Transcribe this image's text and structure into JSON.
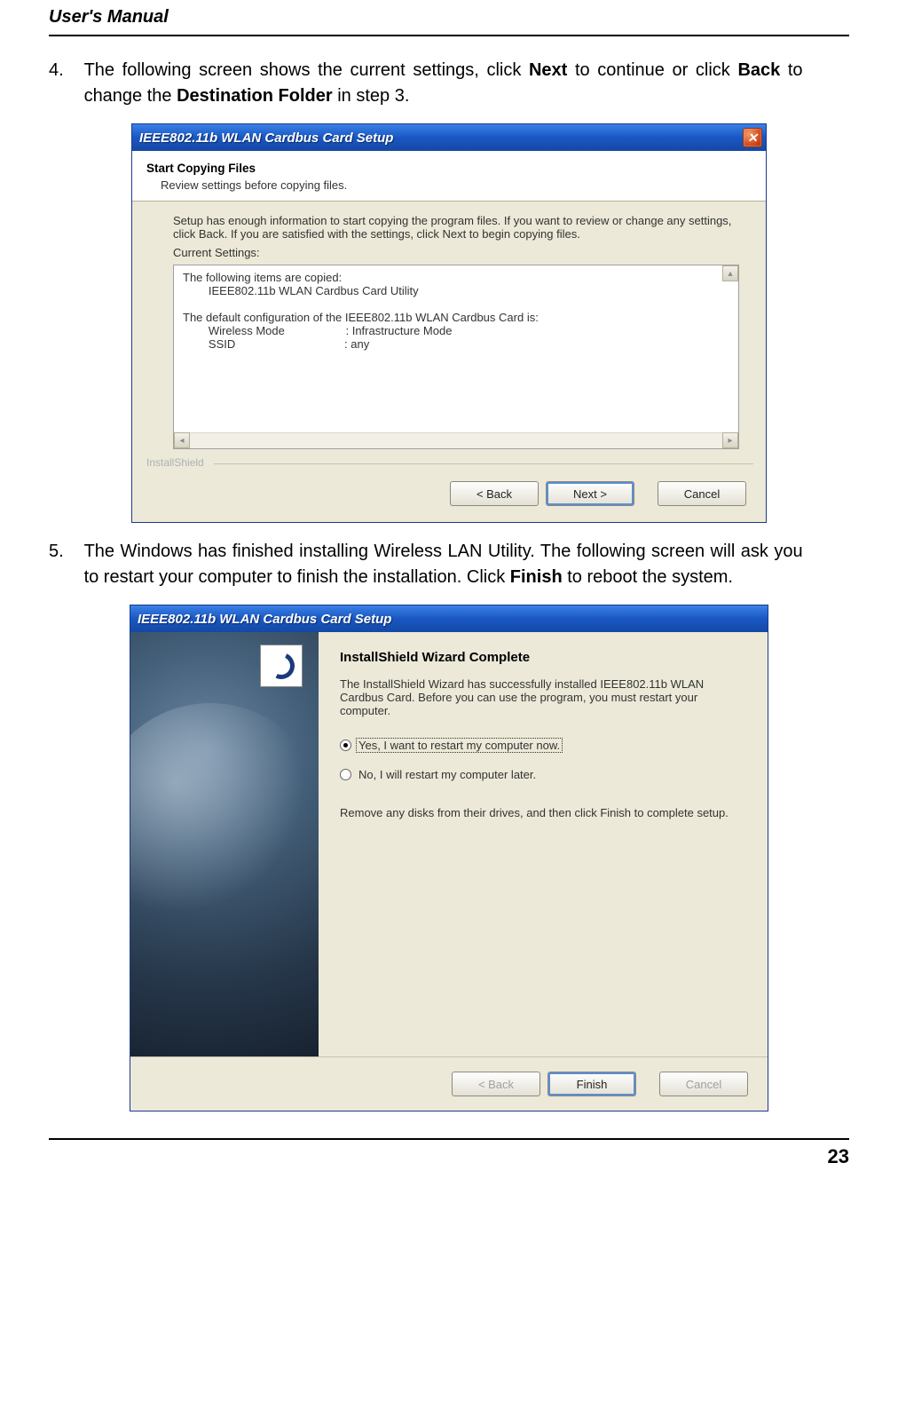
{
  "header": {
    "title": "User's Manual"
  },
  "footer": {
    "page_number": "23"
  },
  "steps": {
    "s4": {
      "num": "4.",
      "p1": "The following screen shows the current settings, click ",
      "b1": "Next",
      "p2": " to continue or click ",
      "b2": "Back",
      "p3": " to change the ",
      "b3": "Destination Folder",
      "p4": " in step 3."
    },
    "s5": {
      "num": "5.",
      "p1": "The Windows has finished installing Wireless LAN Utility. The following screen will ask you to restart your computer to finish the installation. Click ",
      "b1": "Finish",
      "p2": " to reboot the system."
    }
  },
  "dialog1": {
    "title": "IEEE802.11b WLAN Cardbus Card Setup",
    "close": "✕",
    "header_title": "Start Copying Files",
    "header_sub": "Review settings before copying files.",
    "info": "Setup has enough information to start copying the program files.  If you want to review or change any settings, click Back.  If you are satisfied with the settings, click Next to begin copying files.",
    "current_label": "Current Settings:",
    "settings": {
      "l1": "The following items are copied:",
      "l2": "        IEEE802.11b WLAN Cardbus Card Utility",
      "l3": "The default configuration of the IEEE802.11b WLAN Cardbus Card is:",
      "l4": "        Wireless Mode                   : Infrastructure Mode",
      "l5": "        SSID                                  : any"
    },
    "brand": "InstallShield",
    "buttons": {
      "back": "< Back",
      "next": "Next >",
      "cancel": "Cancel"
    }
  },
  "dialog2": {
    "title": "IEEE802.11b WLAN Cardbus Card Setup",
    "heading": "InstallShield Wizard Complete",
    "text": "The InstallShield Wizard has successfully installed IEEE802.11b WLAN Cardbus Card.  Before you can use the program, you must restart your computer.",
    "radio_yes": "Yes, I want to restart my computer now.",
    "radio_no": "No, I will restart my computer later.",
    "remove": "Remove any disks from their drives, and then click Finish to complete setup.",
    "buttons": {
      "back": "< Back",
      "finish": "Finish",
      "cancel": "Cancel"
    }
  }
}
